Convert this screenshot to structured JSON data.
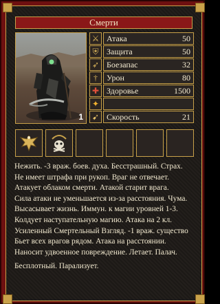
{
  "window": {
    "title": "Смерти"
  },
  "portrait": {
    "count": "1",
    "creature_icon": "grim-reaper-icon"
  },
  "stats": [
    {
      "icon": "sword-icon",
      "label": "Атака",
      "value": "50"
    },
    {
      "icon": "shield-icon",
      "label": "Защита",
      "value": "50"
    },
    {
      "icon": "bow-icon",
      "label": "Боезапас",
      "value": "32"
    },
    {
      "icon": "sword-damage-icon",
      "label": "Урон",
      "value": "80"
    },
    {
      "icon": "health-icon",
      "label": "Здоровье",
      "value": "1500"
    },
    {
      "icon": "mana-icon",
      "label": "",
      "value": ""
    },
    {
      "icon": "speed-icon",
      "label": "Скорость",
      "value": "21"
    }
  ],
  "slots": [
    {
      "icon": "eagle-morale-icon"
    },
    {
      "icon": "skull-luck-icon"
    },
    {
      "icon": ""
    },
    {
      "icon": ""
    },
    {
      "icon": ""
    },
    {
      "icon": ""
    }
  ],
  "description": {
    "lines": [
      "Нежить.  -3 враж. боев. духа. Бесстрашный. Страх.",
      "Не имеет штрафа при рукоп. Враг не отвечает.",
      "Атакует облаком смерти. Атакой старит врага.",
      "Сила атаки не уменьшается из-за расстояния. Чума.",
      "Высасывает жизнь. Иммун. к магии уровней 1-3.",
      "Колдует наступательную магию. Атака на 2 кл.",
      "Усиленный Смертельный Взгляд. -1 враж. существо",
      "Бьет всех врагов рядом. Атака на расстоянии.",
      "Наносит удвоенное повреждение. Летает. Палач."
    ],
    "extra": "Бесплотный. Парализует."
  },
  "colors": {
    "frame": "#6e1010",
    "gold": "#c9a24a",
    "text": "#f3ead0",
    "title_bg": "#8a1818"
  }
}
